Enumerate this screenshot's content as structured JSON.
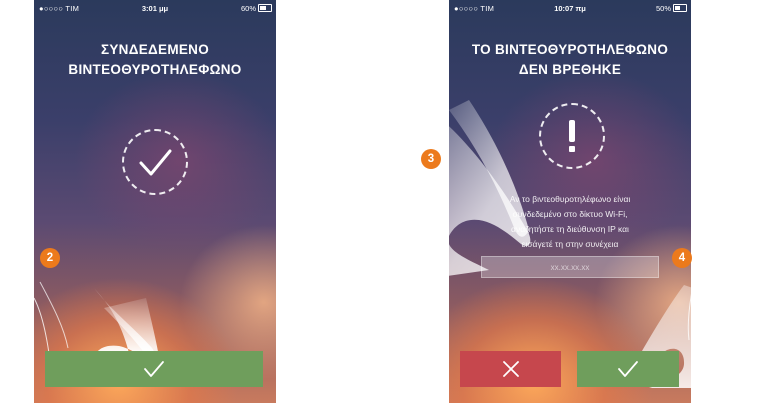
{
  "left_screen": {
    "status": {
      "carrier": "●○○○○ TIM",
      "time": "3:01 μμ",
      "battery": "60%"
    },
    "title_line1": "ΣΥΝΔΕΔΕΜΕΝΟ",
    "title_line2": "ΒΙΝΤΕΟΘΥΡΟΤΗΛΕΦΩΝΟ",
    "status_icon": "check-icon",
    "confirm_icon": "check-icon"
  },
  "right_screen": {
    "status": {
      "carrier": "●○○○○ TIM",
      "time": "10:07 πμ",
      "battery": "50%"
    },
    "title_line1": "ΤΟ ΒΙΝΤΕΟΘΥΡΟΤΗΛΕΦΩΝΟ",
    "title_line2": "ΔΕΝ ΒΡΕΘΗΚΕ",
    "status_icon": "exclamation-icon",
    "message_line1": "Αν το βιντεοθυροτηλέφωνο είναι",
    "message_line2": "συνδεδεμένο στο δίκτυο Wi-Fi,",
    "message_line3": "αναζητήστε τη διεύθυνση IP και",
    "message_line4": "εισάγετέ τη στην συνέχεια",
    "ip_field_value": "",
    "ip_field_placeholder": "xx.xx.xx.xx",
    "cancel_icon": "close-icon",
    "confirm_icon": "check-icon"
  },
  "callouts": [
    "2",
    "3",
    "4"
  ],
  "colors": {
    "accent_orange": "#ec7a1c",
    "confirm_green": "#6f9e5c",
    "cancel_red": "#c6474d"
  }
}
